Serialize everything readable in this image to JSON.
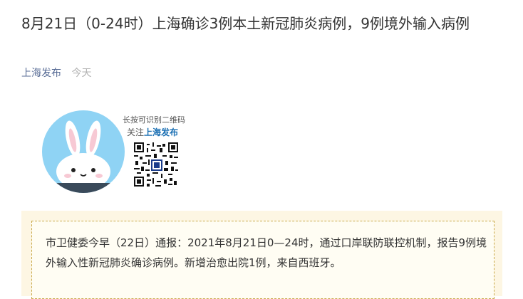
{
  "article": {
    "title": "8月21日（0-24时）上海确诊3例本土新冠肺炎病例，9例境外输入病例",
    "account": "上海发布",
    "date": "今天"
  },
  "qr_card": {
    "tip_line1": "长按可识别二维码",
    "tip_follow": "关注",
    "tip_brand": "上海发布",
    "avatar_icon": "rabbit-mascot-icon"
  },
  "notice": {
    "text": "市卫健委今早（22日）通报：2021年8月21日0—24时，通过口岸联防联控机制，报告9例境外输入性新冠肺炎确诊病例。新增治愈出院1例，来自西班牙。"
  },
  "colors": {
    "account_link": "#576b95",
    "brand_blue": "#1a6fb3",
    "avatar_bg": "#8fd3f4",
    "notice_border": "#c9a94a",
    "notice_bg": "#fdf6e3"
  }
}
